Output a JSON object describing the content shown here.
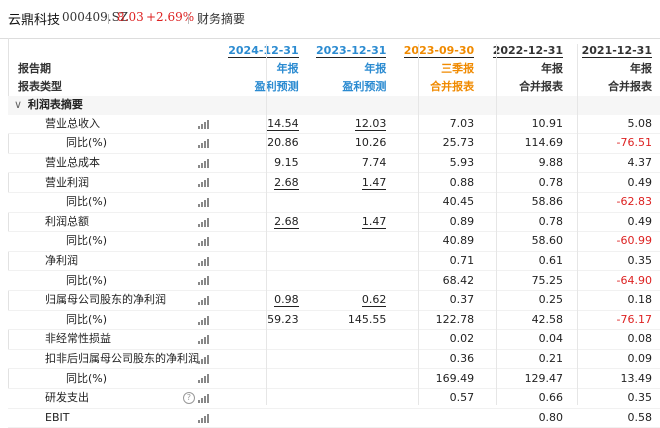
{
  "header": {
    "name": "云鼎科技",
    "code": "000409.SZ",
    "price": "8.03",
    "change": "+2.69%",
    "crumb": "财务摘要"
  },
  "columns": [
    {
      "date": "2024-12-31",
      "period": "年报",
      "type": "盈利预测",
      "color": "#2b8bd1"
    },
    {
      "date": "2023-12-31",
      "period": "年报",
      "type": "盈利预测",
      "color": "#2b8bd1"
    },
    {
      "date": "2023-09-30",
      "period": "三季报",
      "type": "合并报表",
      "color": "#f08a00"
    },
    {
      "date": "2022-12-31",
      "period": "年报",
      "type": "合并报表",
      "color": "#333333"
    },
    {
      "date": "2021-12-31",
      "period": "年报",
      "type": "合并报表",
      "color": "#333333"
    }
  ],
  "labels": {
    "report_period": "报告期",
    "report_type": "报表类型",
    "section": "利润表摘要",
    "section_chevron": "∨"
  },
  "rows": [
    {
      "label": "营业总收入",
      "sub": false,
      "values": [
        "14.54",
        "12.03",
        "7.03",
        "10.91",
        "5.08"
      ],
      "underline": [
        true,
        true,
        false,
        false,
        false
      ],
      "neg": [
        false,
        false,
        false,
        false,
        false
      ]
    },
    {
      "label": "同比(%)",
      "sub": true,
      "values": [
        "20.86",
        "10.26",
        "25.73",
        "114.69",
        "-76.51"
      ],
      "neg": [
        false,
        false,
        false,
        false,
        true
      ]
    },
    {
      "label": "营业总成本",
      "sub": false,
      "values": [
        "9.15",
        "7.74",
        "5.93",
        "9.88",
        "4.37"
      ],
      "neg": [
        false,
        false,
        false,
        false,
        false
      ]
    },
    {
      "label": "营业利润",
      "sub": false,
      "values": [
        "2.68",
        "1.47",
        "0.88",
        "0.78",
        "0.49"
      ],
      "underline": [
        true,
        true,
        false,
        false,
        false
      ],
      "neg": [
        false,
        false,
        false,
        false,
        false
      ]
    },
    {
      "label": "同比(%)",
      "sub": true,
      "values": [
        "",
        "",
        "40.45",
        "58.86",
        "-62.83"
      ],
      "neg": [
        false,
        false,
        false,
        false,
        true
      ]
    },
    {
      "label": "利润总额",
      "sub": false,
      "values": [
        "2.68",
        "1.47",
        "0.89",
        "0.78",
        "0.49"
      ],
      "underline": [
        true,
        true,
        false,
        false,
        false
      ],
      "neg": [
        false,
        false,
        false,
        false,
        false
      ]
    },
    {
      "label": "同比(%)",
      "sub": true,
      "values": [
        "",
        "",
        "40.89",
        "58.60",
        "-60.99"
      ],
      "neg": [
        false,
        false,
        false,
        false,
        true
      ]
    },
    {
      "label": "净利润",
      "sub": false,
      "values": [
        "",
        "",
        "0.71",
        "0.61",
        "0.35"
      ],
      "neg": [
        false,
        false,
        false,
        false,
        false
      ]
    },
    {
      "label": "同比(%)",
      "sub": true,
      "values": [
        "",
        "",
        "68.42",
        "75.25",
        "-64.90"
      ],
      "neg": [
        false,
        false,
        false,
        false,
        true
      ]
    },
    {
      "label": "归属母公司股东的净利润",
      "sub": false,
      "values": [
        "0.98",
        "0.62",
        "0.37",
        "0.25",
        "0.18"
      ],
      "underline": [
        true,
        true,
        false,
        false,
        false
      ],
      "neg": [
        false,
        false,
        false,
        false,
        false
      ]
    },
    {
      "label": "同比(%)",
      "sub": true,
      "values": [
        "59.23",
        "145.55",
        "122.78",
        "42.58",
        "-76.17"
      ],
      "neg": [
        false,
        false,
        false,
        false,
        true
      ]
    },
    {
      "label": "非经常性损益",
      "sub": false,
      "values": [
        "",
        "",
        "0.02",
        "0.04",
        "0.08"
      ],
      "neg": [
        false,
        false,
        false,
        false,
        false
      ]
    },
    {
      "label": "扣非后归属母公司股东的净利润",
      "sub": false,
      "values": [
        "",
        "",
        "0.36",
        "0.21",
        "0.09"
      ],
      "neg": [
        false,
        false,
        false,
        false,
        false
      ]
    },
    {
      "label": "同比(%)",
      "sub": true,
      "values": [
        "",
        "",
        "169.49",
        "129.47",
        "13.49"
      ],
      "neg": [
        false,
        false,
        false,
        false,
        false
      ]
    },
    {
      "label": "研发支出",
      "sub": false,
      "help": true,
      "values": [
        "",
        "",
        "0.57",
        "0.66",
        "0.35"
      ],
      "neg": [
        false,
        false,
        false,
        false,
        false
      ]
    },
    {
      "label": "EBIT",
      "sub": false,
      "values": [
        "",
        "",
        "",
        "0.80",
        "0.58"
      ],
      "neg": [
        false,
        false,
        false,
        false,
        false
      ]
    }
  ],
  "icons": {
    "bar": "bar-chart-icon",
    "help": "help-icon",
    "help_glyph": "?"
  }
}
